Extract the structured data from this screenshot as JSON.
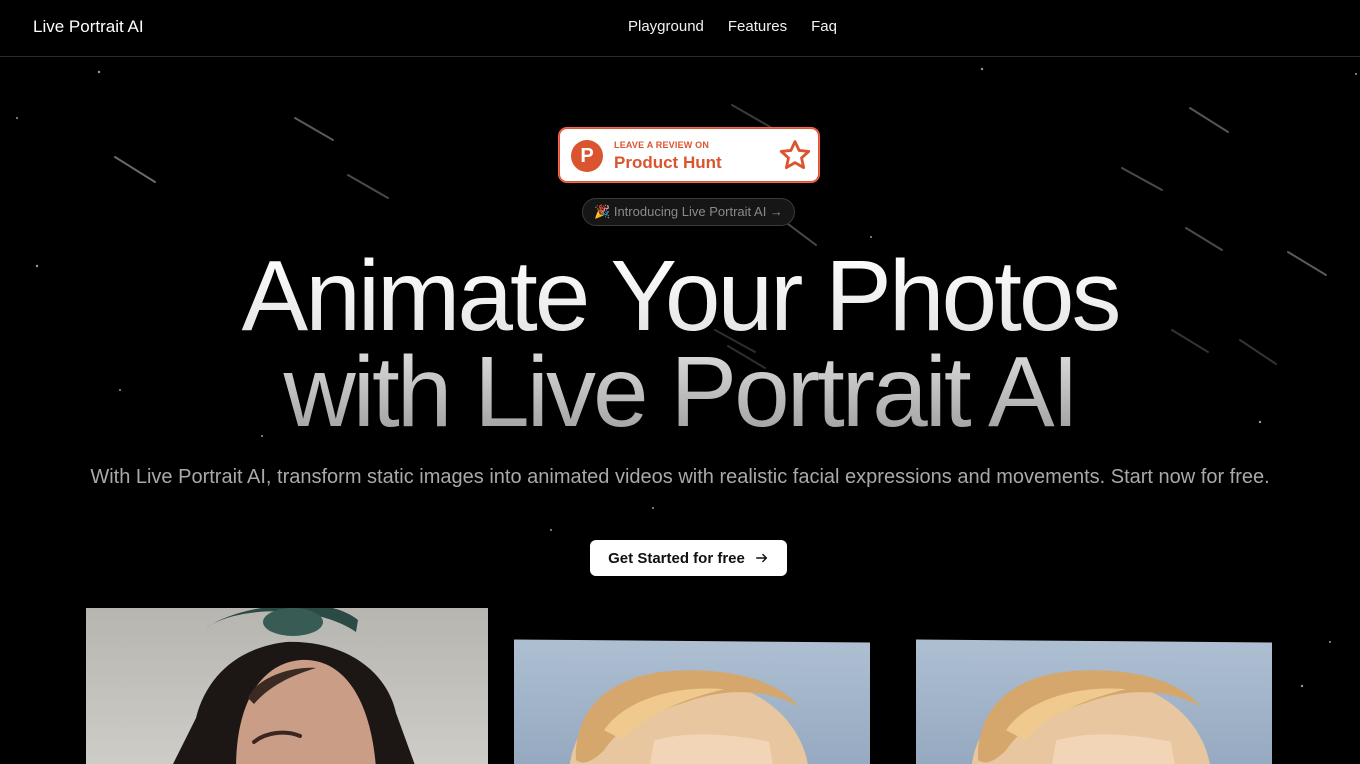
{
  "nav": {
    "brand": "Live Portrait AI",
    "links": [
      "Playground",
      "Features",
      "Faq"
    ]
  },
  "product_hunt": {
    "kicker": "LEAVE A REVIEW ON",
    "name": "Product Hunt",
    "logo_letter": "P",
    "color": "#da552f"
  },
  "intro_pill": "🎉 Introducing Live Portrait AI →",
  "hero": {
    "line1": "Animate Your Photos",
    "line2": "with Live Portrait AI",
    "subtitle": "With Live Portrait AI, transform static images into animated videos with realistic facial expressions and movements. Start now for free.",
    "cta": "Get Started for free"
  },
  "colors": {
    "background": "#000000",
    "cta_bg": "#ffffff",
    "subtitle": "#a8a8ad"
  }
}
